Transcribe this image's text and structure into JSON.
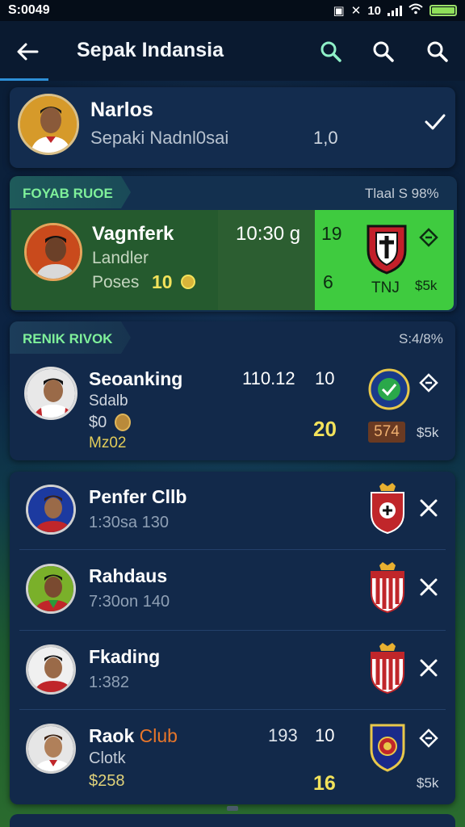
{
  "status": {
    "time": "S:0049",
    "net": "10"
  },
  "appbar": {
    "title": "Sepak Indansia"
  },
  "profile": {
    "name": "Narlos",
    "subtitle": "Sepaki Nadnl0sai",
    "value": "1,0"
  },
  "featured": {
    "label": "FOYAB RUOE",
    "right_label": "Tlaal S 98%",
    "player_name": "Vagnferk",
    "player_sub": "Landler",
    "points_label": "Poses",
    "points_value": "10",
    "time": "10:30 g",
    "stat1": "19",
    "stat2": "6",
    "club_code": "TNJ",
    "extra": "$5k"
  },
  "ranks": {
    "label": "RENIK RIVOK",
    "right_label": "S:4/8%",
    "item": {
      "name": "Seoanking",
      "club": "Sdalb",
      "money": "$0",
      "sub2": "Mz02",
      "time": "110.12",
      "stat": "10",
      "score": "20",
      "badge": "574",
      "extra": "$5k"
    }
  },
  "list": [
    {
      "name": "Penfer Cllb",
      "detail": "1:30sa 130"
    },
    {
      "name": "Rahdaus",
      "detail": "7:30on 140"
    },
    {
      "name": "Fkading",
      "detail": "1:382"
    }
  ],
  "last": {
    "name_a": "Raok",
    "name_b": "Club",
    "sub": "Clotk",
    "money": "$258",
    "time": "193",
    "stat": "10",
    "score": "16",
    "extra": "$5k"
  },
  "colors": {
    "accent": "#2d8fd6",
    "green": "#4ad84a",
    "yellow": "#f2e25b",
    "orange": "#e8762a"
  }
}
